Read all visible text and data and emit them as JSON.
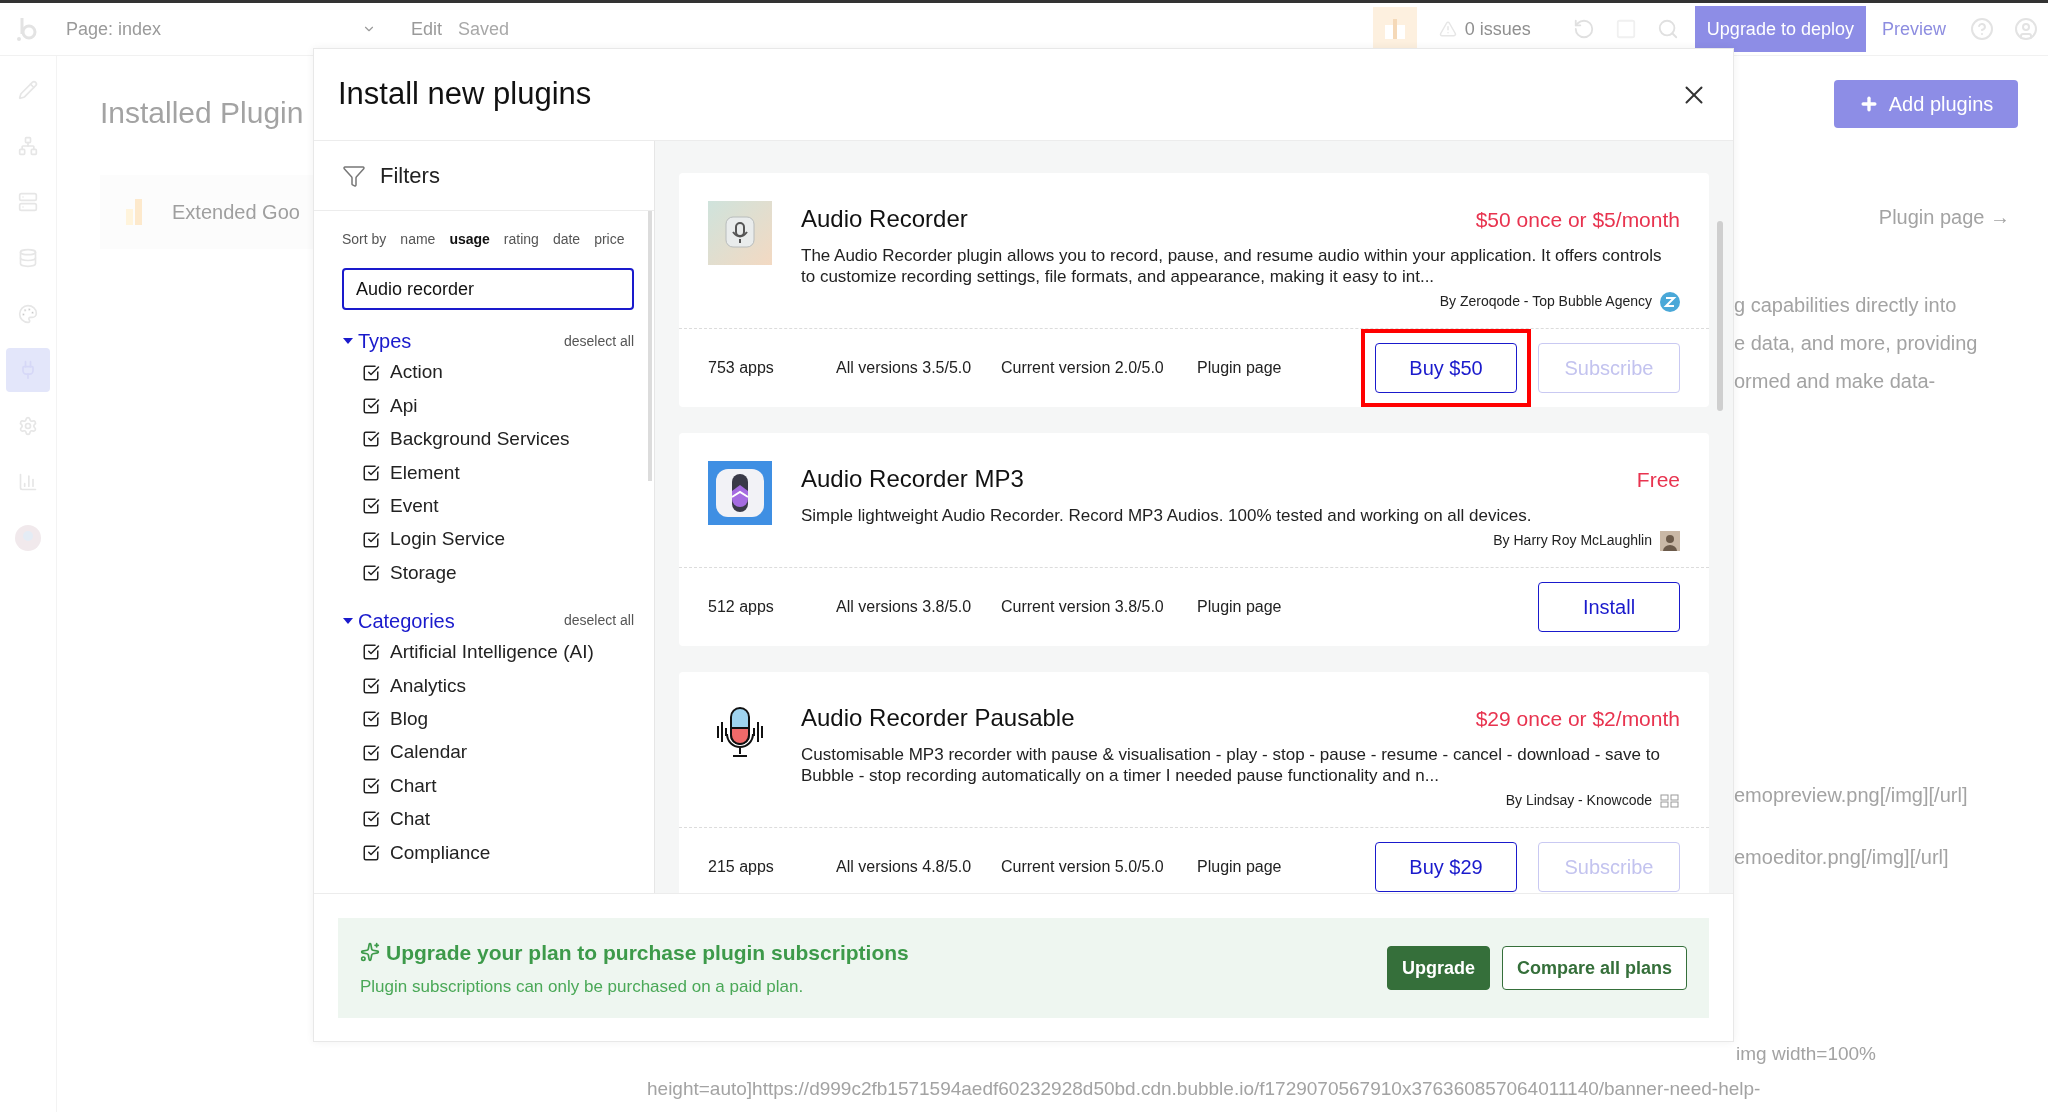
{
  "topbar": {
    "page_selector": "Page: index",
    "menu": "Edit",
    "save_status": "Saved",
    "issues": "0 issues",
    "deploy_button": "Upgrade to deploy",
    "preview": "Preview"
  },
  "rail": [
    {
      "selected": false
    },
    {
      "selected": false
    },
    {
      "selected": false
    },
    {
      "selected": false
    },
    {
      "selected": false
    },
    {
      "selected": true
    },
    {
      "selected": false
    },
    {
      "selected": false
    },
    {
      "selected": false
    }
  ],
  "page": {
    "title": "Installed Plugin",
    "plugin_row": "Extended Goo",
    "add_button": "Add plugins",
    "plugin_link": "Plugin page →",
    "description_lines": [
      "g capabilities directly into",
      "e data, and more, providing",
      "ormed and make data-"
    ],
    "readme_lines": [
      "emopreview.png[/img][/url]",
      "emoeditor.png[/img][/url]",
      "img width=100%",
      "height=auto]https://d999c2fb1571594aedf60232928d50bd.cdn.bubble.io/f1729070567910x376360857064011140/banner-need-help-"
    ]
  },
  "modal": {
    "title": "Install new plugins",
    "filters": {
      "title": "Filters",
      "sort_label": "Sort by",
      "sort_options": [
        {
          "label": "name",
          "selected": false
        },
        {
          "label": "usage",
          "selected": true
        },
        {
          "label": "rating",
          "selected": false
        },
        {
          "label": "date",
          "selected": false
        },
        {
          "label": "price",
          "selected": false
        }
      ],
      "search": {
        "value": "Audio recorder"
      },
      "groups": [
        {
          "title": "Types",
          "expanded": true,
          "action": "deselect all",
          "items": [
            {
              "label": "Action",
              "checked": true
            },
            {
              "label": "Api",
              "checked": true
            },
            {
              "label": "Background Services",
              "checked": true
            },
            {
              "label": "Element",
              "checked": true
            },
            {
              "label": "Event",
              "checked": true
            },
            {
              "label": "Login Service",
              "checked": true
            },
            {
              "label": "Storage",
              "checked": true
            }
          ]
        },
        {
          "title": "Categories",
          "expanded": true,
          "action": "deselect all",
          "items": [
            {
              "label": "Artificial Intelligence (AI)",
              "checked": true
            },
            {
              "label": "Analytics",
              "checked": true
            },
            {
              "label": "Blog",
              "checked": true
            },
            {
              "label": "Calendar",
              "checked": true
            },
            {
              "label": "Chart",
              "checked": true
            },
            {
              "label": "Chat",
              "checked": true
            },
            {
              "label": "Compliance",
              "checked": true
            }
          ]
        }
      ]
    },
    "plugins": [
      {
        "name": "Audio Recorder",
        "price": "$50 once or $5/month",
        "description": "The Audio Recorder plugin allows you to record, pause, and resume audio within your application. It offers controls to customize recording settings, file formats, and appearance, making it easy to int...",
        "author": "By Zeroqode - Top Bubble Agency",
        "apps": "753 apps",
        "all_versions": "All versions 3.5/5.0",
        "current_version": "Current version 2.0/5.0",
        "link": "Plugin page",
        "buttons": [
          {
            "label": "Buy $50",
            "disabled": false,
            "highlighted": true
          },
          {
            "label": "Subscribe",
            "disabled": true,
            "highlighted": false
          }
        ]
      },
      {
        "name": "Audio Recorder MP3",
        "price": "Free",
        "description": "Simple lightweight Audio Recorder. Record MP3 Audios. 100% tested and working on all devices.",
        "author": "By Harry Roy McLaughlin",
        "apps": "512 apps",
        "all_versions": "All versions 3.8/5.0",
        "current_version": "Current version 3.8/5.0",
        "link": "Plugin page",
        "buttons": [
          {
            "label": "Install",
            "disabled": false,
            "highlighted": false
          }
        ]
      },
      {
        "name": "Audio Recorder Pausable",
        "price": "$29 once or $2/month",
        "description": "Customisable MP3 recorder with pause & visualisation - play - stop - pause - resume - cancel - download - save to Bubble - stop recording automatically on a timer I needed pause functionality and n...",
        "author": "By Lindsay - Knowcode",
        "apps": "215 apps",
        "all_versions": "All versions 4.8/5.0",
        "current_version": "Current version 5.0/5.0",
        "link": "Plugin page",
        "buttons": [
          {
            "label": "Buy $29",
            "disabled": false,
            "highlighted": false
          },
          {
            "label": "Subscribe",
            "disabled": true,
            "highlighted": false
          }
        ]
      }
    ],
    "upgrade_banner": {
      "title": "Upgrade your plan to purchase plugin subscriptions",
      "text": "Plugin subscriptions can only be purchased on a paid plan.",
      "buttons": [
        {
          "label": "Upgrade",
          "kind": "primary"
        },
        {
          "label": "Compare all plans",
          "kind": "outline"
        }
      ]
    }
  }
}
